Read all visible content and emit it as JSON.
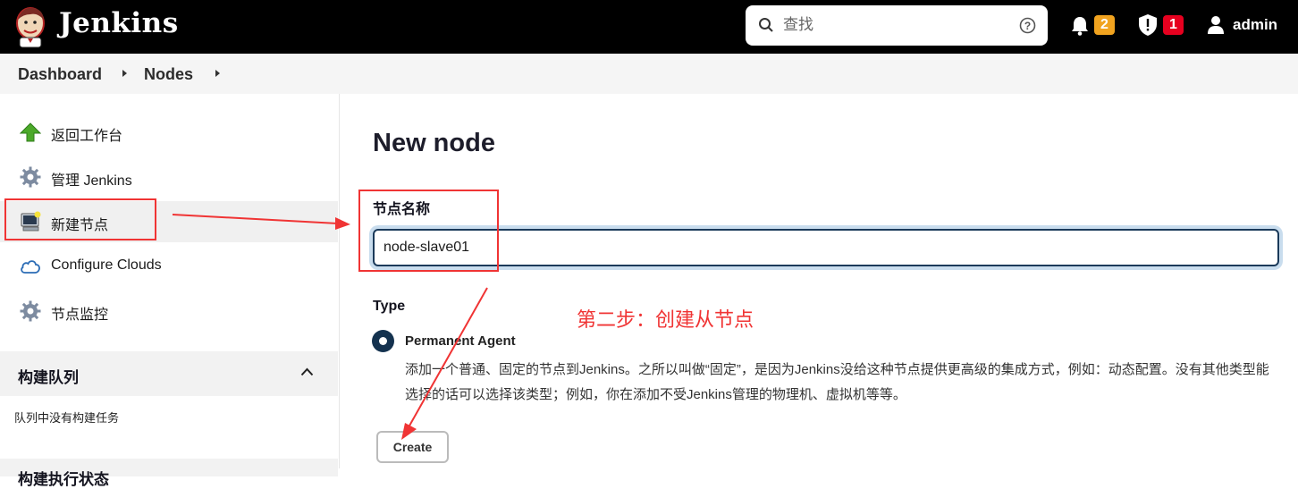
{
  "header": {
    "brand": "Jenkins",
    "search_placeholder": "查找",
    "notifications_count": "2",
    "security_count": "1",
    "user": "admin",
    "colors": {
      "bar": "#000000",
      "notify_badge": "#f1a31f",
      "security_badge": "#e6001f"
    }
  },
  "breadcrumb": [
    "Dashboard",
    "Nodes"
  ],
  "sidebar": {
    "tasks": [
      {
        "label": "返回工作台",
        "icon": "up-arrow-icon"
      },
      {
        "label": "管理 Jenkins",
        "icon": "gear-icon"
      },
      {
        "label": "新建节点",
        "icon": "computer-icon"
      },
      {
        "label": "Configure Clouds",
        "icon": "cloud-icon"
      },
      {
        "label": "节点监控",
        "icon": "gear-icon"
      }
    ],
    "build_queue_title": "构建队列",
    "build_queue_empty": "队列中没有构建任务",
    "executor_title": "构建执行状态"
  },
  "main": {
    "title": "New node",
    "name_label": "节点名称",
    "name_value": "node-slave01",
    "type_label": "Type",
    "option_label": "Permanent Agent",
    "option_desc": "添加一个普通、固定的节点到Jenkins。之所以叫做“固定”，是因为Jenkins没给这种节点提供更高级的集成方式，例如：动态配置。没有其他类型能选择的话可以选择该类型；例如，你在添加不受Jenkins管理的物理机、虚拟机等等。",
    "create_label": "Create"
  },
  "annotation": {
    "step_text": "第二步：创建从节点",
    "color": "#f03434"
  }
}
